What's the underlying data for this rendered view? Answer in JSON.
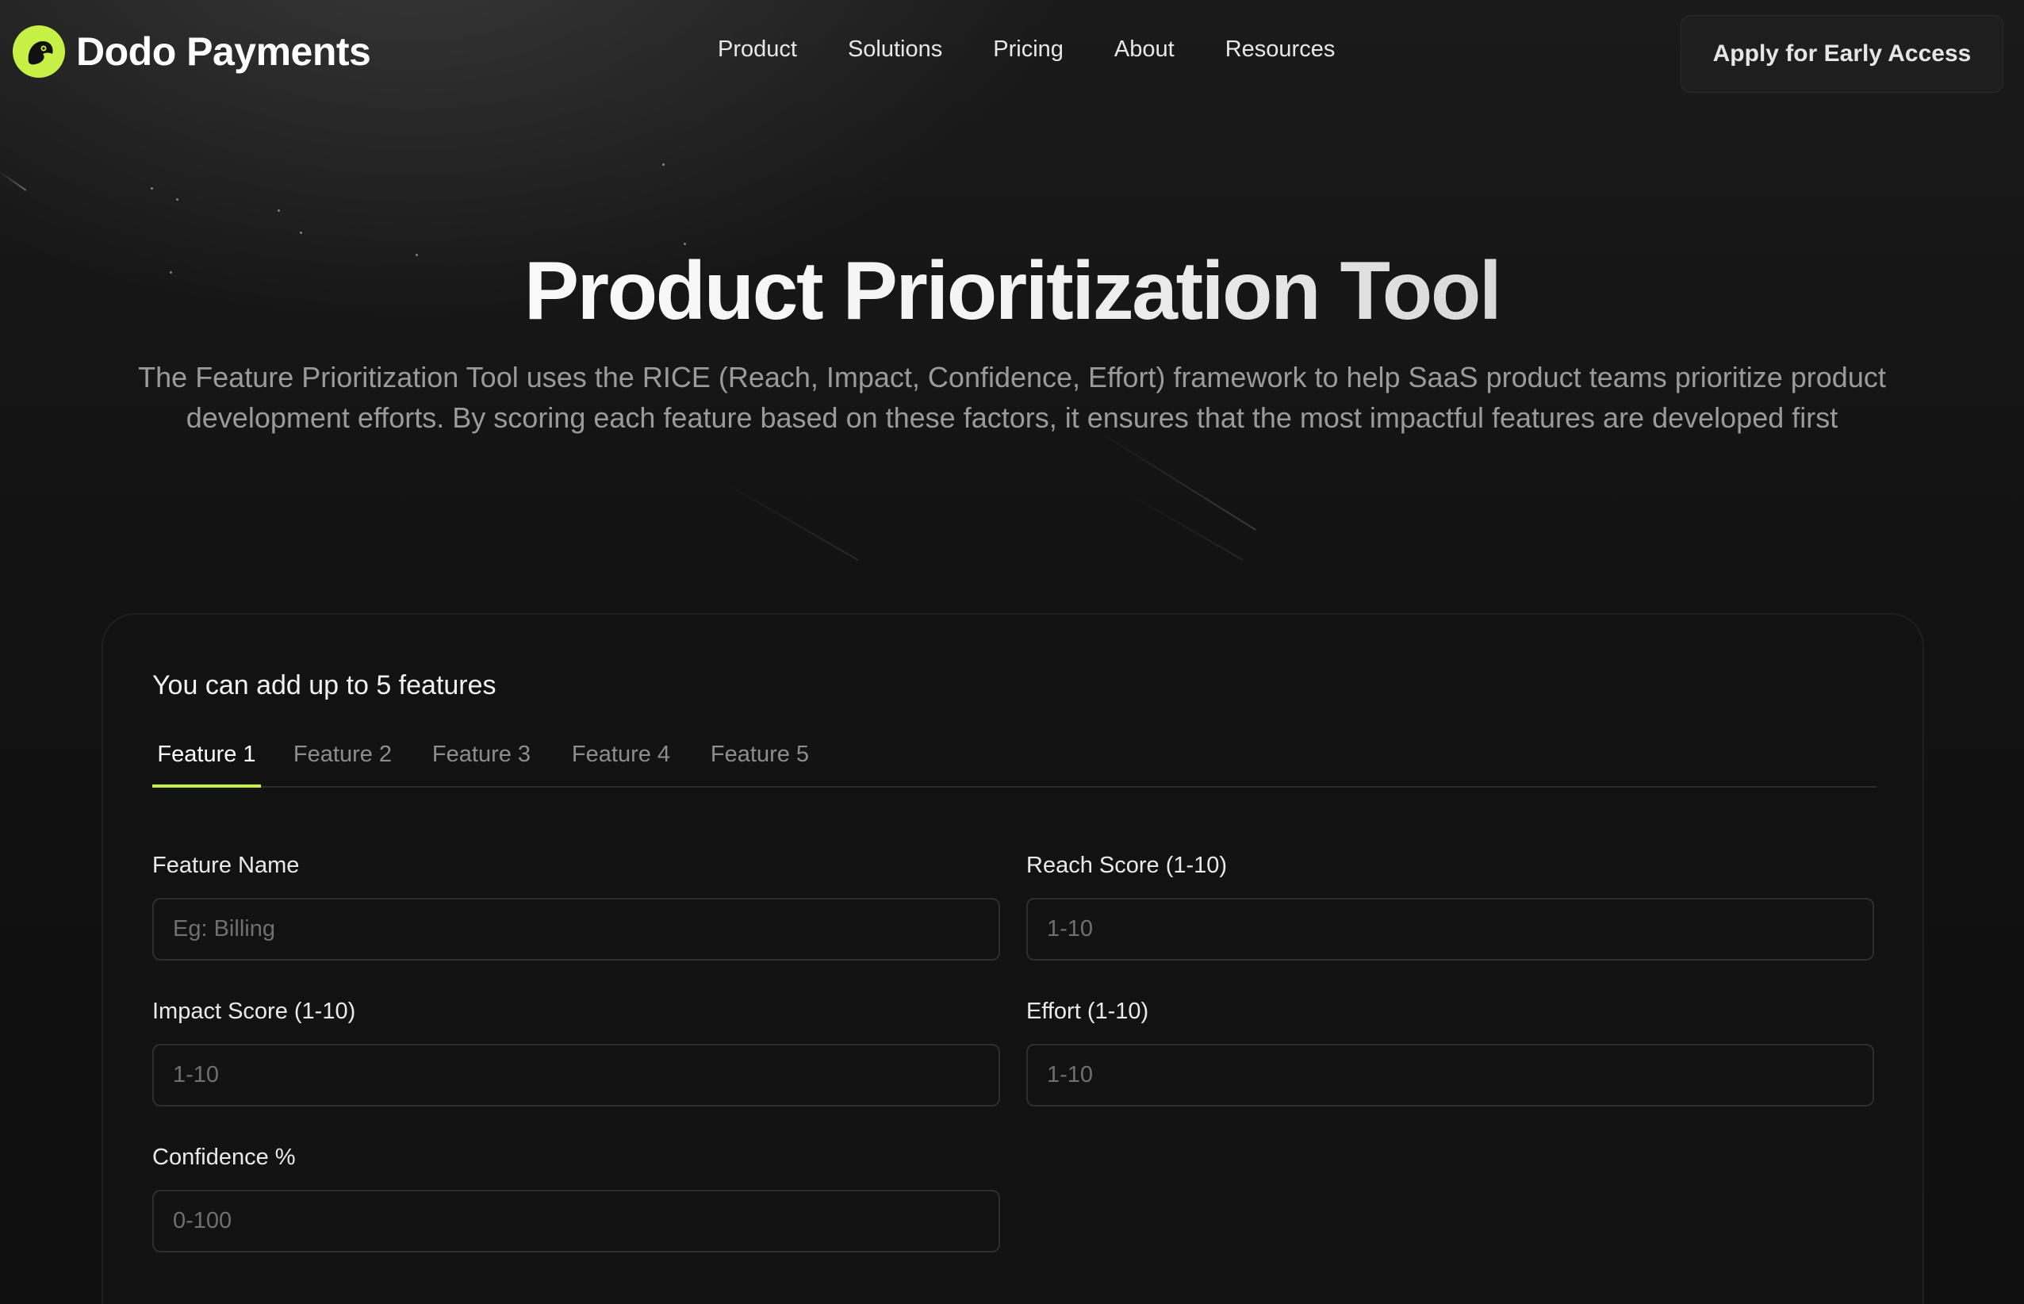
{
  "brand": {
    "name": "Dodo Payments",
    "accent": "#c6f045",
    "logo_icon": "dodo-bird-icon"
  },
  "nav": {
    "links": [
      "Product",
      "Solutions",
      "Pricing",
      "About",
      "Resources"
    ],
    "cta": "Apply for Early Access"
  },
  "hero": {
    "title": "Product Prioritization Tool",
    "description": "The Feature Prioritization Tool uses the RICE (Reach, Impact, Confidence, Effort) framework to help SaaS product teams prioritize product development efforts. By scoring each feature based on these factors, it ensures that the most impactful features are developed first"
  },
  "form": {
    "heading": "You can add up to 5 features",
    "tabs": [
      "Feature 1",
      "Feature 2",
      "Feature 3",
      "Feature 4",
      "Feature 5"
    ],
    "active_tab": "Feature 1",
    "fields": {
      "feature_name": {
        "label": "Feature Name",
        "placeholder": "Eg: Billing",
        "value": ""
      },
      "reach": {
        "label": "Reach Score (1-10)",
        "placeholder": "1-10",
        "value": ""
      },
      "impact": {
        "label": "Impact Score (1-10)",
        "placeholder": "1-10",
        "value": ""
      },
      "effort": {
        "label": "Effort (1-10)",
        "placeholder": "1-10",
        "value": ""
      },
      "confidence": {
        "label": "Confidence %",
        "placeholder": "0-100",
        "value": ""
      }
    }
  }
}
